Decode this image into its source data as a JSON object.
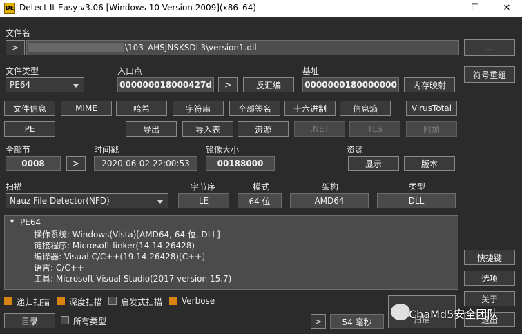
{
  "window": {
    "title": "Detect It Easy v3.06 [Windows 10 Version 2009](x86_64)",
    "icon_text": "DE",
    "minimize": "—",
    "maximize": "☐",
    "close": "✕"
  },
  "file": {
    "label": "文件名",
    "browse_arrow": ">",
    "path_visible": "\\103_AHSJNSKSDL3\\version1.dll",
    "more_button": "..."
  },
  "filetype": {
    "label": "文件类型",
    "value": "PE64"
  },
  "entry": {
    "label": "入口点",
    "value": "000000018000427d",
    "go_arrow": ">",
    "disasm_button": "反汇编"
  },
  "base": {
    "label": "基址",
    "value": "0000000180000000",
    "memmap_button": "内存映射"
  },
  "side_buttons": {
    "symbols": "符号重组",
    "shortcuts": "快捷键",
    "options": "选项",
    "about": "关于",
    "exit": "退出"
  },
  "toolbar_row1": [
    "文件信息",
    "MIME",
    "哈希",
    "字符串",
    "全部签名",
    "十六进制",
    "信息熵",
    "VirusTotal"
  ],
  "toolbar_row2": {
    "pe": "PE",
    "export": "导出",
    "import": "导入表",
    "resources": "资源",
    "net": ".NET",
    "tls": "TLS",
    "overlay": "附加"
  },
  "sections": {
    "label": "全部节",
    "value": "0008",
    "arrow": ">"
  },
  "timestamp": {
    "label": "时间戳",
    "value": "2020-06-02 22:00:53"
  },
  "image_size": {
    "label": "镜像大小",
    "value": "00188000"
  },
  "resources": {
    "label": "资源",
    "show_button": "显示",
    "version_button": "版本"
  },
  "scan": {
    "label": "扫描",
    "engine": "Nauz File Detector(NFD)",
    "endian_label": "字节序",
    "endian_value": "LE",
    "mode_label": "模式",
    "mode_value": "64 位",
    "arch_label": "架构",
    "arch_value": "AMD64",
    "type_label": "类型",
    "type_value": "DLL"
  },
  "result": {
    "root": "PE64",
    "expander": "▾",
    "lines": [
      "操作系统: Windows(Vista)[AMD64, 64 位, DLL]",
      "链接程序: Microsoft linker(14.14.26428)",
      "编译器: Visual C/C++(19.14.26428)[C++]",
      "语言: C/C++",
      "工具: Microsoft Visual Studio(2017 version 15.7)"
    ]
  },
  "options": [
    {
      "label": "递归扫描",
      "checked": true
    },
    {
      "label": "深度扫描",
      "checked": true
    },
    {
      "label": "启发式扫描",
      "checked": false
    },
    {
      "label": "Verbose",
      "checked": true
    }
  ],
  "bottom": {
    "directory_button": "目录",
    "all_types_label": "所有类型",
    "all_types_checked": false,
    "scan_arrow": ">",
    "elapsed": "54 毫秒",
    "scan_button_partial": "扫描"
  },
  "watermark": "ChaMd5安全团队",
  "colors": {
    "background": "#2b2b2b",
    "field": "#4a4a4a",
    "checkbox_on": "#d98312"
  }
}
